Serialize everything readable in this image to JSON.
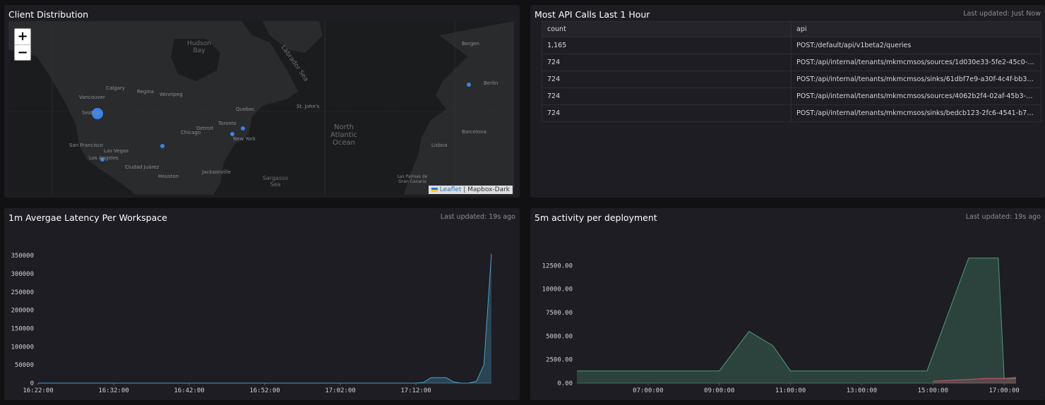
{
  "panels": {
    "client_distribution": {
      "title": "Client Distribution",
      "zoom_in": "+",
      "zoom_out": "−",
      "attribution_link": "Leaflet",
      "attribution_sep": " | ",
      "attribution_text": "Mapbox-Dark",
      "labels": [
        "Hudson Bay",
        "Labrador Sea",
        "North Atlantic Ocean",
        "Sargasso Sea",
        "Calgary",
        "Regina",
        "Winnipeg",
        "Vancouver",
        "Seattle",
        "San Francisco",
        "Las Vegas",
        "Los Angeles",
        "Chicago",
        "Detroit",
        "Toronto",
        "Quebec",
        "New York",
        "Jacksonville",
        "Houston",
        "Ciudad Juárez",
        "Bergen",
        "Berlin",
        "Barcelona",
        "Lisboa",
        "Las Palmas de Gran Canaria",
        "St. John's"
      ]
    },
    "api_calls": {
      "title": "Most API Calls Last 1 Hour",
      "meta": "Last updated: Just Now",
      "columns": [
        "count",
        "api"
      ],
      "rows": [
        [
          "1,165",
          "POST:/default/api/v1beta2/queries"
        ],
        [
          "724",
          "POST:/api/internal/tenants/mkmcmsos/sources/1d030e33-5fe2-45c0-9646-d..."
        ],
        [
          "724",
          "POST:/api/internal/tenants/mkmcmsos/sinks/61dbf7e9-a30f-4c4f-bb3e-74e3..."
        ],
        [
          "724",
          "POST:/api/internal/tenants/mkmcmsos/sources/4062b2f4-02af-45b3-be99-9f..."
        ],
        [
          "724",
          "POST:/api/internal/tenants/mkmcmsos/sinks/bedcb123-2fc6-4541-b7d7-74b..."
        ]
      ]
    },
    "latency": {
      "title": "1m Avergae Latency Per Workspace",
      "meta": "Last updated: 19s ago"
    },
    "activity": {
      "title": "5m activity per deployment",
      "meta": "Last updated: 19s ago"
    }
  },
  "chart_data": [
    {
      "type": "area",
      "title": "1m Avergae Latency Per Workspace",
      "x_ticks": [
        "16:22:00",
        "16:32:00",
        "16:42:00",
        "16:52:00",
        "17:02:00",
        "17:12:00"
      ],
      "y_ticks": [
        "0",
        "50000",
        "100000",
        "150000",
        "200000",
        "250000",
        "300000",
        "350000"
      ],
      "ylim": [
        0,
        360000
      ],
      "series": [
        {
          "color": "#4a9fc7",
          "x": [
            "16:22:00",
            "16:30:00",
            "16:40:00",
            "16:50:00",
            "17:00:00",
            "17:08:00",
            "17:12:00",
            "17:13:00",
            "17:14:00",
            "17:15:00",
            "17:16:00",
            "17:17:00",
            "17:18:00",
            "17:19:00",
            "17:20:00",
            "17:21:00",
            "17:22:00"
          ],
          "values": [
            0,
            0,
            0,
            0,
            0,
            0,
            0,
            2000,
            15000,
            15000,
            15000,
            3000,
            0,
            0,
            5000,
            50000,
            355000
          ]
        }
      ]
    },
    {
      "type": "area",
      "title": "5m activity per deployment",
      "x_ticks": [
        "07:00:00",
        "09:00:00",
        "11:00:00",
        "13:00:00",
        "15:00:00",
        "17:00:00"
      ],
      "y_ticks": [
        "0.00",
        "2500.00",
        "5000.00",
        "7500.00",
        "10000.00",
        "12500.00"
      ],
      "ylim": [
        0,
        13200
      ],
      "series": [
        {
          "color": "#4f9a7c",
          "x": [
            "05:00",
            "06:00",
            "07:00",
            "08:00",
            "09:00",
            "09:50",
            "10:30",
            "11:00",
            "12:00",
            "13:00",
            "14:00",
            "14:50",
            "16:00",
            "16:50",
            "17:00",
            "17:20"
          ],
          "values": [
            1300,
            1300,
            1300,
            1300,
            1300,
            5500,
            4000,
            1300,
            1300,
            1300,
            1300,
            1300,
            13300,
            13300,
            500,
            500
          ]
        },
        {
          "color": "#c65a6e",
          "x": [
            "15:00",
            "15:30",
            "16:00",
            "16:30",
            "17:00",
            "17:20"
          ],
          "values": [
            200,
            300,
            400,
            500,
            500,
            600
          ]
        }
      ]
    }
  ]
}
